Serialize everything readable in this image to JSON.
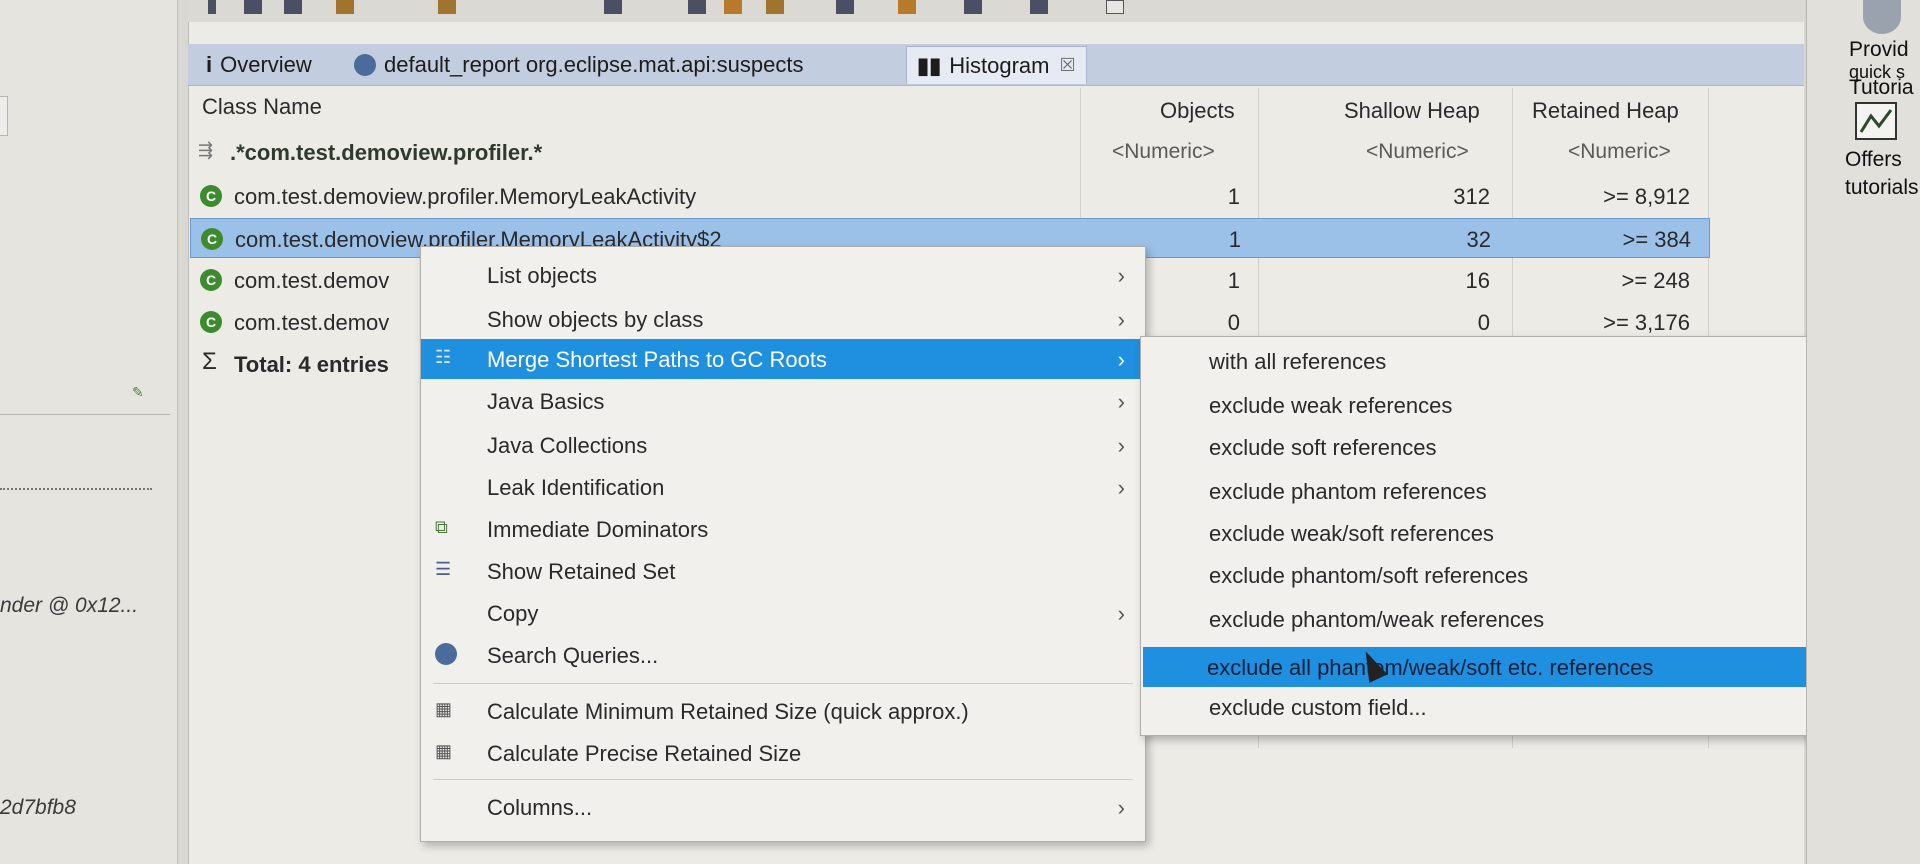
{
  "left": {
    "text1": "nder @ 0x12...",
    "text2": "2d7bfb8"
  },
  "tabs": [
    {
      "icon": "i",
      "label": "Overview"
    },
    {
      "label": "default_report  org.eclipse.mat.api:suspects"
    },
    {
      "label": "Histogram",
      "close": "☒"
    }
  ],
  "table": {
    "headers": {
      "class_name": "Class Name",
      "objects": "Objects",
      "shallow": "Shallow Heap",
      "retained": "Retained Heap"
    },
    "filter": {
      "class_name": ".*com.test.demoview.profiler.*",
      "objects": "<Numeric>",
      "shallow": "<Numeric>",
      "retained": "<Numeric>"
    },
    "rows": [
      {
        "name": "com.test.demoview.profiler.MemoryLeakActivity",
        "objects": "1",
        "shallow": "312",
        "retained": ">= 8,912"
      },
      {
        "name": "com.test.demoview.profiler.MemoryLeakActivity$2",
        "objects": "1",
        "shallow": "32",
        "retained": ">= 384"
      },
      {
        "name": "com.test.demov",
        "objects": "1",
        "shallow": "16",
        "retained": ">= 248"
      },
      {
        "name": "com.test.demov",
        "objects": "0",
        "shallow": "0",
        "retained": ">= 3,176"
      }
    ],
    "total": "Total: 4 entries"
  },
  "context_menu": {
    "items": [
      {
        "label": "List objects"
      },
      {
        "label": "Show objects by class"
      },
      {
        "label": "Merge Shortest Paths to GC Roots"
      },
      {
        "label": "Java Basics"
      },
      {
        "label": "Java Collections"
      },
      {
        "label": "Leak Identification"
      },
      {
        "label": "Immediate Dominators"
      },
      {
        "label": "Show Retained Set"
      },
      {
        "label": "Copy"
      },
      {
        "label": "Search Queries..."
      },
      {
        "label": "Calculate Minimum Retained Size (quick approx.)"
      },
      {
        "label": "Calculate Precise Retained Size"
      },
      {
        "label": "Columns..."
      }
    ]
  },
  "submenu": {
    "items": [
      {
        "label": "with all references"
      },
      {
        "label": "exclude weak references"
      },
      {
        "label": "exclude soft references"
      },
      {
        "label": "exclude phantom references"
      },
      {
        "label": "exclude weak/soft references"
      },
      {
        "label": "exclude phantom/soft references"
      },
      {
        "label": "exclude phantom/weak references"
      },
      {
        "label": "exclude all phantom/weak/soft etc. references"
      },
      {
        "label": "exclude custom field..."
      }
    ]
  },
  "right_pane": {
    "t1": "Provid",
    "t2": "quick s",
    "t3": "Tutoria",
    "t4": "Offers",
    "t5": "tutorials"
  },
  "colors": {
    "highlight": "#1f8fe0",
    "row_selected": "#9cc1e9",
    "class_icon": "#3d8b2f",
    "tab_bar": "#c2cde0"
  }
}
